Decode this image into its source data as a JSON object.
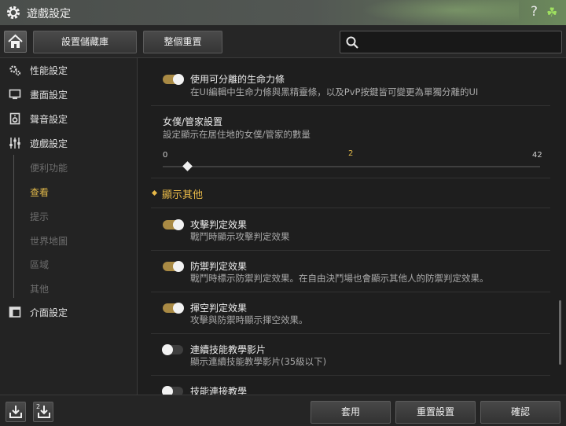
{
  "window": {
    "title": "遊戲設定",
    "help": "?",
    "clover": "☘"
  },
  "toolbar": {
    "library_label": "設置儲藏庫",
    "reset_all_label": "整個重置",
    "search": {
      "value": "",
      "placeholder": ""
    }
  },
  "sidebar": {
    "items": [
      {
        "label": "性能設定",
        "icon": "performance-icon"
      },
      {
        "label": "畫面設定",
        "icon": "monitor-icon"
      },
      {
        "label": "聲音設定",
        "icon": "speaker-icon"
      },
      {
        "label": "遊戲設定",
        "icon": "sliders-icon"
      },
      {
        "label": "介面設定",
        "icon": "interface-icon"
      }
    ],
    "subitems": [
      {
        "label": "便利功能",
        "active": false
      },
      {
        "label": "查看",
        "active": true
      },
      {
        "label": "提示",
        "active": false
      },
      {
        "label": "世界地圖",
        "active": false
      },
      {
        "label": "區域",
        "active": false
      },
      {
        "label": "其他",
        "active": false
      }
    ]
  },
  "content": {
    "hp_bar": {
      "title": "使用可分離的生命力條",
      "desc": "在UI編輯中生命力條與黑精靈條，以及PvP按鍵皆可變更為單獨分離的UI",
      "enabled": true
    },
    "maid": {
      "title": "女僕/管家設置",
      "desc": "設定顯示在居住地的女僕/管家的數量",
      "min": "0",
      "value": "2",
      "max": "42"
    },
    "section": {
      "title": "顯示其他"
    },
    "options": [
      {
        "title": "攻擊判定效果",
        "desc": "戰鬥時顯示攻擊判定效果",
        "enabled": true
      },
      {
        "title": "防禦判定效果",
        "desc": "戰鬥時標示防禦判定效果。在自由決鬥場也會顯示其他人的防禦判定效果。",
        "enabled": true
      },
      {
        "title": "揮空判定效果",
        "desc": "攻擊與防禦時顯示揮空效果。",
        "enabled": true
      },
      {
        "title": "連續技能教學影片",
        "desc": "顯示連續技能教學影片(35級以下)",
        "enabled": false
      },
      {
        "title": "技能連接教學",
        "desc": "",
        "enabled": false
      }
    ]
  },
  "bottom": {
    "apply_label": "套用",
    "reset_label": "重置設置",
    "confirm_label": "確認",
    "export2_badge": "2"
  },
  "colors": {
    "accent": "#e0b84a",
    "toggle_on": "#a98a44",
    "toggle_off": "#3e3e3e"
  }
}
